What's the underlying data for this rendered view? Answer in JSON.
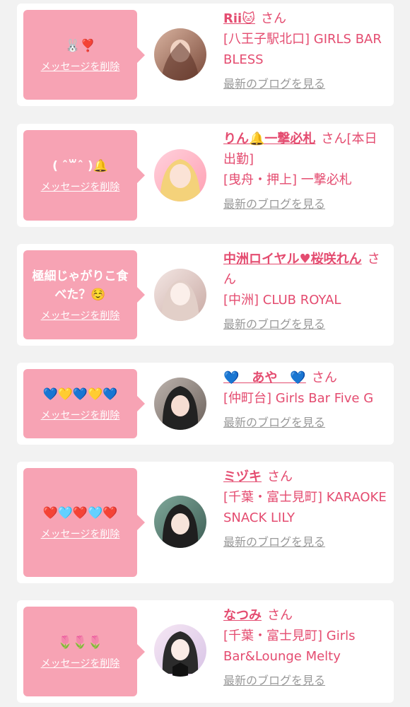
{
  "colors": {
    "accent_pink": "#e44c70",
    "bubble_pink": "#f7a3b4",
    "link_gray": "#999999",
    "card_bg": "#ffffff",
    "page_bg": "#f2f2f2"
  },
  "cards": [
    {
      "message": "🐰❣️",
      "delete_label": "メッセージを削除",
      "girl_name": "Rii🐱",
      "suffix": "さん",
      "shop": "[八王子駅北口] GIRLS BAR BLESS",
      "blog_label": "最新のブログを見る",
      "avatar_icon": "avatar-photo"
    },
    {
      "message": "( ˆ꒳ˆ )🔔",
      "delete_label": "メッセージを削除",
      "girl_name": "りん🔔一撃必札",
      "suffix": "さん[本日出勤]",
      "shop": "[曳舟・押上] 一撃必札",
      "blog_label": "最新のブログを見る",
      "avatar_icon": "avatar-photo"
    },
    {
      "message": "極細じゃがりこ食べた？☺️",
      "delete_label": "メッセージを削除",
      "girl_name": "中洲ロイヤル♥桜咲れん",
      "suffix": "さん",
      "shop": "[中洲] CLUB ROYAL",
      "blog_label": "最新のブログを見る",
      "avatar_icon": "avatar-photo"
    },
    {
      "message": "💙💛💙💛💙",
      "delete_label": "メッセージを削除",
      "girl_name": "💙　あや　💙",
      "suffix": "さん",
      "shop": "[仲町台] Girls Bar Five G",
      "blog_label": "最新のブログを見る",
      "avatar_icon": "avatar-photo"
    },
    {
      "message": "❤️🩵❤️🩵❤️",
      "delete_label": "メッセージを削除",
      "girl_name": "ミヅキ",
      "suffix": "さん",
      "shop": "[千葉・富士見町] KARAOKE SNACK LILY",
      "blog_label": "最新のブログを見る",
      "avatar_icon": "avatar-photo"
    },
    {
      "message": "🌷🌷🌷",
      "delete_label": "メッセージを削除",
      "girl_name": "なつみ",
      "suffix": "さん",
      "shop": "[千葉・富士見町] Girls Bar&Lounge Melty",
      "blog_label": "最新のブログを見る",
      "avatar_icon": "avatar-photo"
    }
  ]
}
